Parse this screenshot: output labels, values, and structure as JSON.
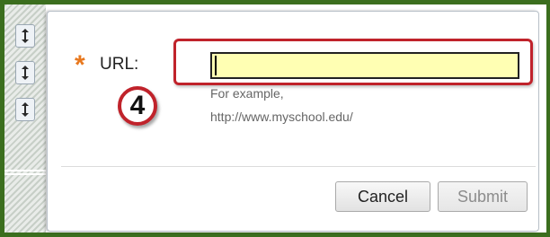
{
  "form": {
    "required_mark": "*",
    "url_label": "URL:",
    "url_value": "",
    "hint_line1": "For example,",
    "hint_line2": "http://www.myschool.edu/",
    "step_number": "4"
  },
  "buttons": {
    "cancel": "Cancel",
    "submit": "Submit"
  },
  "icons": {
    "left_handles": [
      "resize-vertical-icon",
      "resize-vertical-icon",
      "resize-vertical-icon"
    ]
  },
  "colors": {
    "frame_green": "#3b6e1e",
    "required_orange": "#e8781e",
    "highlight_red": "#c0232b",
    "input_yellow": "#ffffb3"
  }
}
